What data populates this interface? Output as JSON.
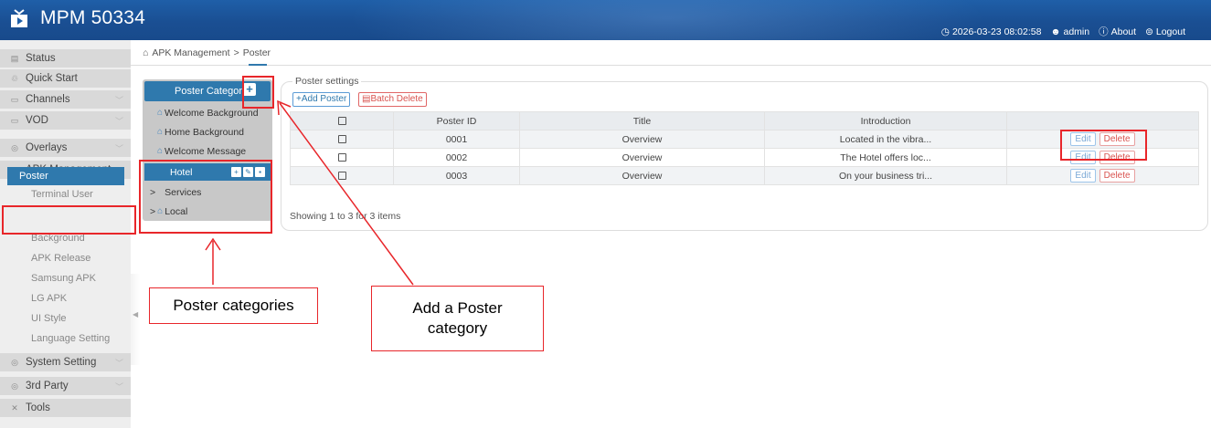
{
  "header": {
    "title": "MPM 50334",
    "datetime": "2026-03-23 08:02:58",
    "user": "admin",
    "about": "About",
    "logout": "Logout"
  },
  "sidebar": {
    "items": [
      {
        "label": "Status",
        "icon": "status-icon"
      },
      {
        "label": "Quick Start",
        "icon": "quick-start-icon"
      },
      {
        "label": "Channels",
        "icon": "channels-icon"
      },
      {
        "label": "VOD",
        "icon": "vod-icon"
      },
      {
        "label": "Overlays",
        "icon": "overlays-icon"
      },
      {
        "label": "APK Management",
        "icon": "apk-icon"
      },
      {
        "label": "System Setting",
        "icon": "system-icon"
      },
      {
        "label": "3rd Party",
        "icon": "third-party-icon"
      },
      {
        "label": "Tools",
        "icon": "tools-icon"
      }
    ],
    "sub_items": [
      "Terminal User",
      "Poster",
      "Background",
      "APK Release",
      "Samsung APK",
      "LG APK",
      "UI Style",
      "Language Setting"
    ]
  },
  "breadcrumb": {
    "home": "APK Management",
    "separator": ">",
    "current": "Poster"
  },
  "category_panel": {
    "title": "Poster Category",
    "add_icon": "plus-icon",
    "items": [
      "Welcome Background",
      "Home Background",
      "Welcome Message",
      "Hotel",
      "Services",
      "Local"
    ]
  },
  "poster_settings": {
    "legend": "Poster settings",
    "add_label": "+Add Poster",
    "batch_delete_label": "Batch Delete",
    "columns": [
      "Poster ID",
      "Title",
      "Introduction"
    ],
    "rows": [
      {
        "id": "0001",
        "title": "Overview",
        "intro": "Located in the vibra..."
      },
      {
        "id": "0002",
        "title": "Overview",
        "intro": "The Hotel offers loc..."
      },
      {
        "id": "0003",
        "title": "Overview",
        "intro": "On your business tri..."
      }
    ],
    "edit_label": "Edit",
    "delete_label": "Delete",
    "showing": "Showing 1 to 3 for 3 items"
  },
  "annotations": {
    "poster_categories": "Poster categories",
    "add_category_line1": "Add a Poster",
    "add_category_line2": "category"
  },
  "colors": {
    "header": "#1f5fa8",
    "accent": "#2f79ad",
    "annotation": "#e8262a"
  }
}
